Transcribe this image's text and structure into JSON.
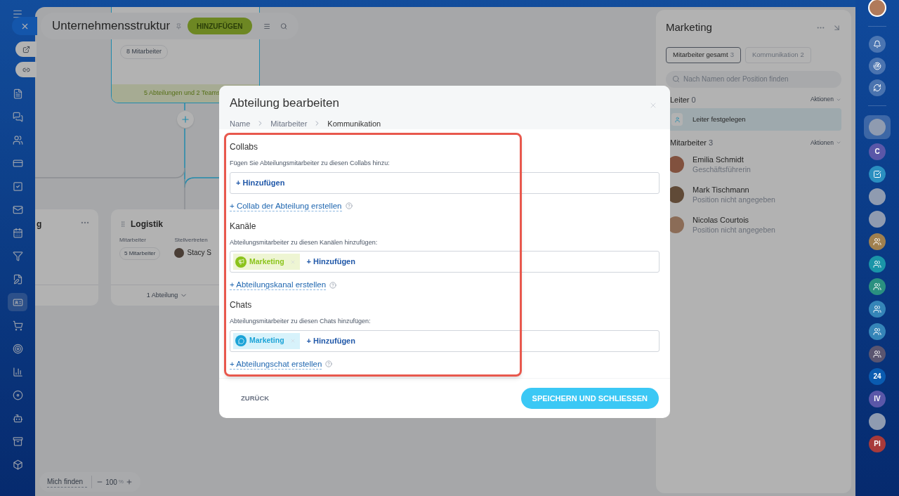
{
  "left_nav": [
    {
      "selected": false
    },
    {
      "selected": false
    },
    {
      "selected": false
    },
    {
      "selected": false
    },
    {
      "selected": false
    },
    {
      "selected": false
    },
    {
      "selected": false
    },
    {
      "selected": false
    },
    {
      "selected": false
    },
    {
      "selected": true
    },
    {
      "selected": false
    },
    {
      "selected": false
    },
    {
      "selected": false
    },
    {
      "selected": false
    },
    {
      "selected": false
    },
    {
      "selected": false
    },
    {
      "selected": false
    }
  ],
  "header": {
    "title": "Unternehmensstruktur",
    "add_button": "HINZUFÜGEN"
  },
  "canvas": {
    "top_card": {
      "employees": "8 Mitarbeiter",
      "footer": "5 Abteilungen und 2 Teams"
    },
    "left_card": {
      "title": "g"
    },
    "logistics_card": {
      "title": "Logistik",
      "employees_label": "Mitarbeiter",
      "employees": "5 Mitarbeiter",
      "deputy_label": "Stellvertreten",
      "deputy": "Stacy S",
      "footer": "1 Abteilung"
    }
  },
  "zoom_bar": {
    "find_me": "Mich finden",
    "zoom": "100",
    "unit": "%"
  },
  "modal": {
    "title": "Abteilung bearbeiten",
    "breadcrumbs": [
      {
        "label": "Name",
        "selected": false
      },
      {
        "label": "Mitarbeiter",
        "selected": false
      },
      {
        "label": "Kommunikation",
        "selected": true
      }
    ],
    "sections": [
      {
        "title": "Collabs",
        "hint": "Fügen Sie Abteilungsmitarbeiter zu diesen Collabs hinzu:",
        "add": "+ Hinzufügen",
        "create_link": "+ Collab der Abteilung erstellen"
      },
      {
        "title": "Kanäle",
        "hint": "Abteilungsmitarbeiter zu diesen Kanälen hinzufügen:",
        "chips": [
          {
            "kind": "channel",
            "label": "Marketing"
          }
        ],
        "add": "+ Hinzufügen",
        "create_link": "+ Abteilungskanal erstellen"
      },
      {
        "title": "Chats",
        "hint": "Abteilungsmitarbeiter zu diesen Chats hinzufügen:",
        "chips": [
          {
            "kind": "chat",
            "label": "Marketing"
          }
        ],
        "add": "+ Hinzufügen",
        "create_link": "+ Abteilungschat erstellen"
      }
    ],
    "back_button": "ZURÜCK",
    "save_button": "SPEICHERN UND SCHLIESSEN"
  },
  "panel": {
    "title": "Marketing",
    "tabs": [
      {
        "label": "Mitarbeiter gesamt",
        "count": "3",
        "selected": true
      },
      {
        "label": "Kommunikation",
        "count": "2",
        "selected": false
      }
    ],
    "search": {
      "placeholder": "Nach Namen oder Position finden"
    },
    "head_section": {
      "title": "Leiter",
      "count": "0",
      "actions": "Aktionen",
      "placeholder_row": "Leiter festgelegen"
    },
    "staff_section": {
      "title": "Mitarbeiter",
      "count": "3",
      "actions": "Aktionen"
    },
    "employees": [
      {
        "name": "Emilia Schmidt",
        "position": "Geschäftsführerin"
      },
      {
        "name": "Mark Tischmann",
        "position": "Position nicht angegeben"
      },
      {
        "name": "Nicolas Courtois",
        "position": "Position nicht angegeben"
      }
    ]
  },
  "right_bar": [
    {
      "kind": "photo",
      "selected": true
    },
    {
      "kind": "letter",
      "text": "C",
      "color": "#5a57a8",
      "selected": false
    },
    {
      "kind": "task",
      "color": "#2a8fc0",
      "selected": false
    },
    {
      "kind": "photo",
      "selected": false
    },
    {
      "kind": "photo",
      "selected": false
    },
    {
      "kind": "group",
      "color": "#a0804f",
      "selected": false
    },
    {
      "kind": "group",
      "color": "#1a95a8",
      "selected": false
    },
    {
      "kind": "group",
      "color": "#2a9080",
      "selected": false
    },
    {
      "kind": "group",
      "color": "#3585b8",
      "selected": false
    },
    {
      "kind": "group",
      "color": "#3585b8",
      "selected": false
    },
    {
      "kind": "group",
      "color": "#5a5570",
      "selected": false
    },
    {
      "kind": "letter",
      "text": "24",
      "color": "#0a5bb0",
      "selected": false
    },
    {
      "kind": "letter",
      "text": "IV",
      "color": "#5a57a8",
      "selected": false
    },
    {
      "kind": "photo",
      "selected": false
    },
    {
      "kind": "letter",
      "text": "PI",
      "color": "#a83a3a",
      "selected": false
    }
  ]
}
